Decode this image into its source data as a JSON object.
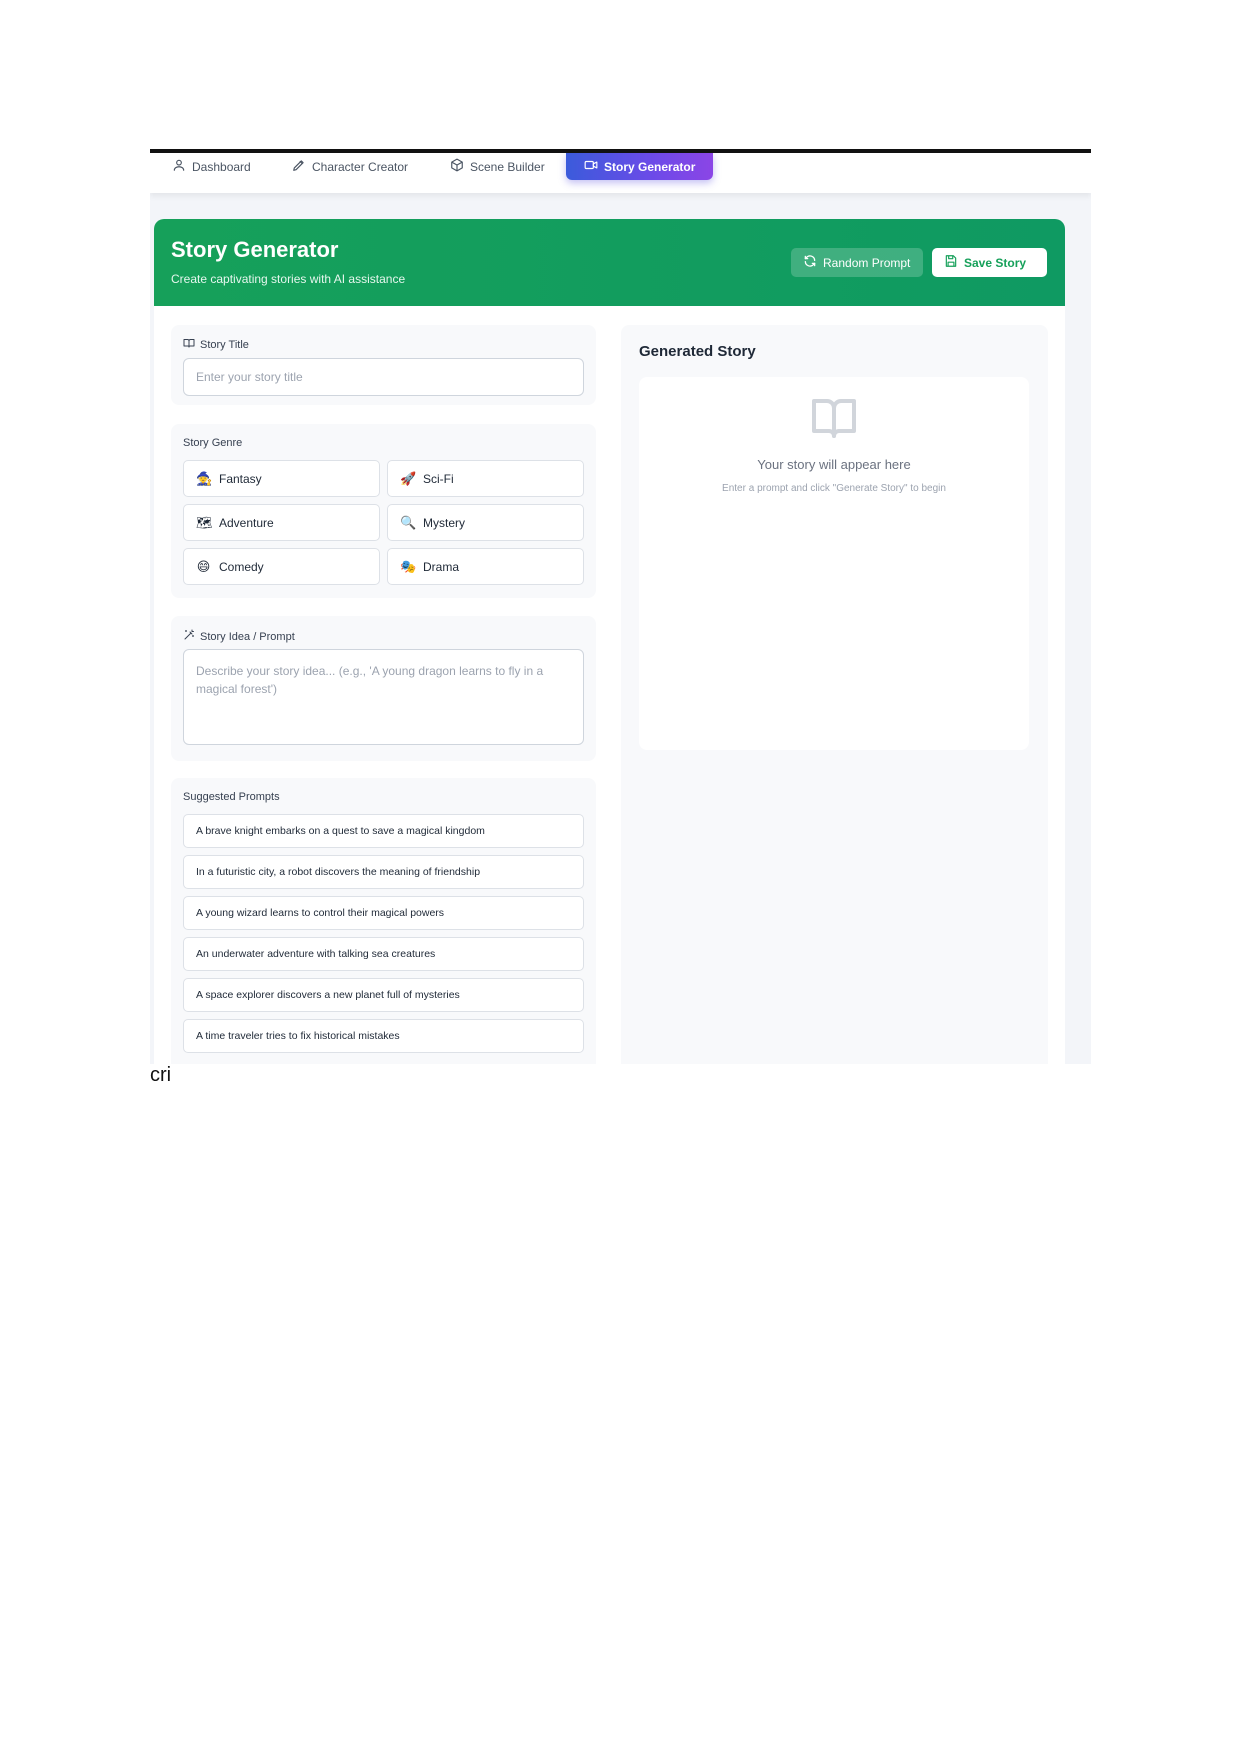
{
  "nav": {
    "items": [
      {
        "label": "Dashboard",
        "icon": "user-icon"
      },
      {
        "label": "Character Creator",
        "icon": "brush-icon"
      },
      {
        "label": "Scene Builder",
        "icon": "cube-icon"
      },
      {
        "label": "Story Generator",
        "icon": "video-icon",
        "active": true
      }
    ]
  },
  "header": {
    "title": "Story Generator",
    "subtitle": "Create captivating stories with AI assistance",
    "random_label": "Random Prompt",
    "save_label": "Save Story"
  },
  "form": {
    "title_label": "Story Title",
    "title_placeholder": "Enter your story title",
    "genre_label": "Story Genre",
    "genres": [
      {
        "emoji": "🧙",
        "label": "Fantasy"
      },
      {
        "emoji": "🚀",
        "label": "Sci-Fi"
      },
      {
        "emoji": "🗺",
        "label": "Adventure"
      },
      {
        "emoji": "🔍",
        "label": "Mystery"
      },
      {
        "emoji": "😄",
        "label": "Comedy"
      },
      {
        "emoji": "🎭",
        "label": "Drama"
      }
    ],
    "prompt_label": "Story Idea / Prompt",
    "prompt_placeholder": "Describe your story idea... (e.g., 'A young dragon learns to fly in a magical forest')",
    "suggested_label": "Suggested Prompts",
    "suggested": [
      "A brave knight embarks on a quest to save a magical kingdom",
      "In a futuristic city, a robot discovers the meaning of friendship",
      "A young wizard learns to control their magical powers",
      "An underwater adventure with talking sea creatures",
      "A space explorer discovers a new planet full of mysteries",
      "A time traveler tries to fix historical mistakes"
    ]
  },
  "output": {
    "title": "Generated Story",
    "empty_main": "Your story will appear here",
    "empty_sub": "Enter a prompt and click \"Generate Story\" to begin"
  },
  "footer_text": "cri",
  "colors": {
    "header_green": "#16a05a",
    "active_tab_start": "#3b5bdb",
    "active_tab_end": "#8b45e6"
  }
}
